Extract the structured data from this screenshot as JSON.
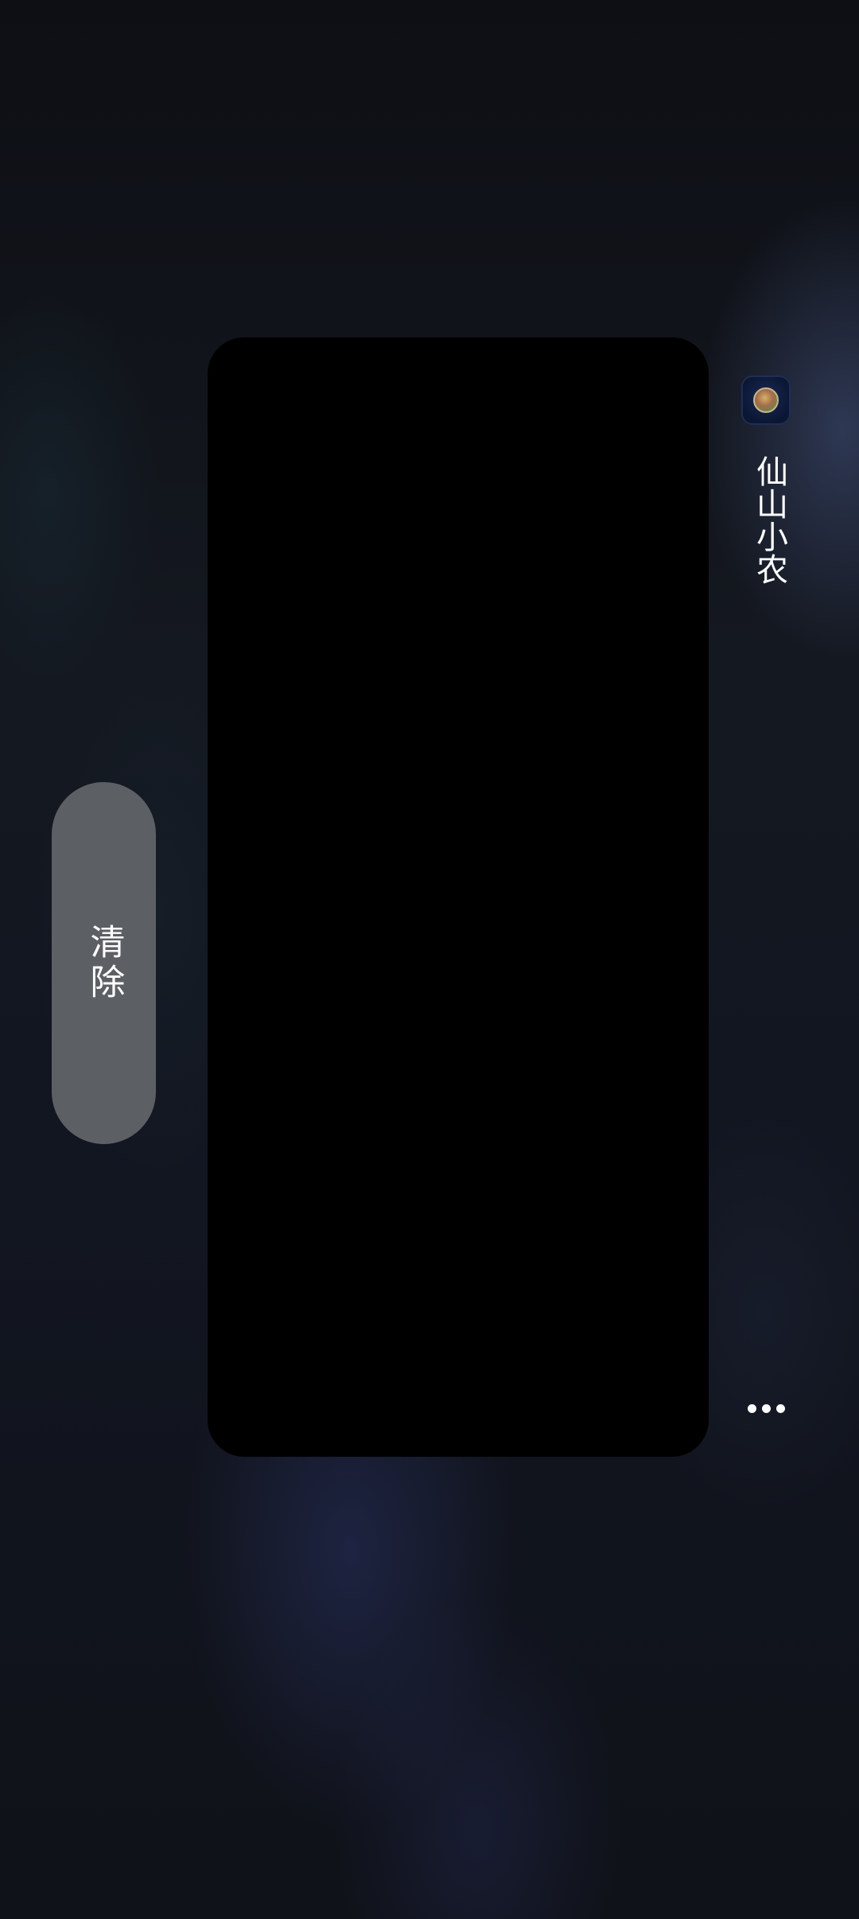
{
  "recents": {
    "clear_label": "清除",
    "app": {
      "name": "仙山小农",
      "icon": "app-icon"
    },
    "more_icon": "more-dots-icon"
  },
  "colors": {
    "card": "#000000",
    "clear_button": "#5c5f64",
    "text": "#ffffff"
  }
}
